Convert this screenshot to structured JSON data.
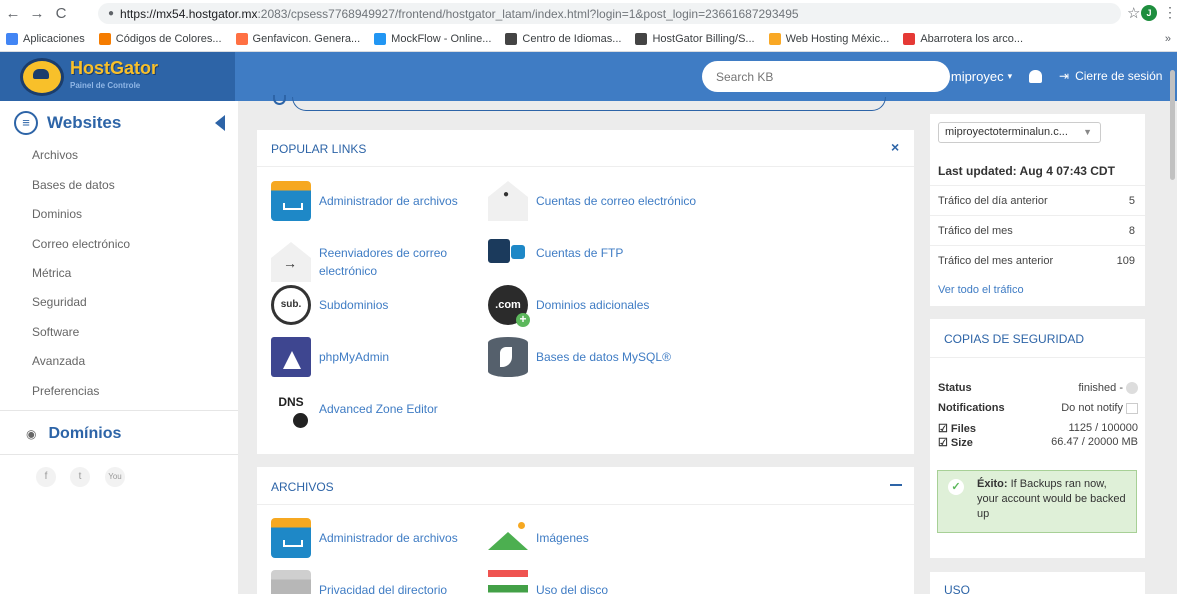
{
  "browser": {
    "url_host": "https://mx54.hostgator.mx",
    "url_path": ":2083/cpsess7768949927/frontend/hostgator_latam/index.html?login=1&post_login=23661687293495",
    "profile_initial": "J",
    "bookmarks": [
      {
        "label": "Aplicaciones",
        "color": "#4285f4"
      },
      {
        "label": "Códigos de Colores...",
        "color": "#f57c00"
      },
      {
        "label": "Genfavicon. Genera...",
        "color": "#ff7043"
      },
      {
        "label": "MockFlow - Online...",
        "color": "#2196f3"
      },
      {
        "label": "Centro de Idiomas...",
        "color": "#444444"
      },
      {
        "label": "HostGator Billing/S...",
        "color": "#444444"
      },
      {
        "label": "Web Hosting Méxic...",
        "color": "#f9a825"
      },
      {
        "label": "Abarrotera los arco...",
        "color": "#e53935"
      }
    ],
    "more": "»"
  },
  "header": {
    "brand": "HostGator",
    "subtitle": "Painel de Controle",
    "search_placeholder": "Search KB",
    "user": "miproyec",
    "logout": "Cierre de sesión"
  },
  "sidebar": {
    "section_title": "Websites",
    "items": [
      "Archivos",
      "Bases de datos",
      "Dominios",
      "Correo electrónico",
      "Métrica",
      "Seguridad",
      "Software",
      "Avanzada",
      "Preferencias"
    ],
    "domains_title": "Domínios",
    "social": [
      "f",
      "t",
      "You"
    ]
  },
  "popular": {
    "title": "POPULAR LINKS",
    "close": "×",
    "links": [
      {
        "label": "Administrador de archivos",
        "icon": "folder-icon"
      },
      {
        "label": "Cuentas de correo electrónico",
        "icon": "envelope-icon"
      },
      {
        "label": "Reenviadores de correo electrónico",
        "icon": "forwarder-icon"
      },
      {
        "label": "Cuentas de FTP",
        "icon": "ftp-icon"
      },
      {
        "label": "Subdominios",
        "icon": "subdomain-icon",
        "icon_text": "sub."
      },
      {
        "label": "Dominios adicionales",
        "icon": "addon-domain-icon",
        "icon_text": ".com"
      },
      {
        "label": "phpMyAdmin",
        "icon": "phpmyadmin-icon"
      },
      {
        "label": "Bases de datos MySQL®",
        "icon": "mysql-icon"
      },
      {
        "label": "Advanced Zone Editor",
        "icon": "dns-icon",
        "icon_text": "DNS"
      }
    ]
  },
  "archivos": {
    "title": "ARCHIVOS",
    "links": [
      {
        "label": "Administrador de archivos",
        "icon": "folder-icon"
      },
      {
        "label": "Imágenes",
        "icon": "image-icon"
      },
      {
        "label": "Privacidad del directorio",
        "icon": "folder-lock-icon"
      },
      {
        "label": "Uso del disco",
        "icon": "disk-usage-icon"
      }
    ]
  },
  "stats": {
    "domain": "miproyectoterminalun.c...",
    "last_updated": "Last updated: Aug 4 07:43 CDT",
    "rows": [
      {
        "label": "Tráfico del día anterior",
        "value": "5"
      },
      {
        "label": "Tráfico del mes",
        "value": "8"
      },
      {
        "label": "Tráfico del mes anterior",
        "value": "109"
      }
    ],
    "link": "Ver todo el tráfico"
  },
  "backups": {
    "title": "COPIAS DE SEGURIDAD",
    "status_label": "Status",
    "status_value": "finished -",
    "notif_label": "Notifications",
    "notif_value": "Do not notify",
    "files_label": "☑ Files",
    "files_value": "1125 / 100000",
    "size_label": "☑ Size",
    "size_value": "66.47 / 20000 MB",
    "alert_bold": "Éxito:",
    "alert_text": "If Backups ran now, your account would be backed up"
  },
  "uso": {
    "title": "USO"
  }
}
